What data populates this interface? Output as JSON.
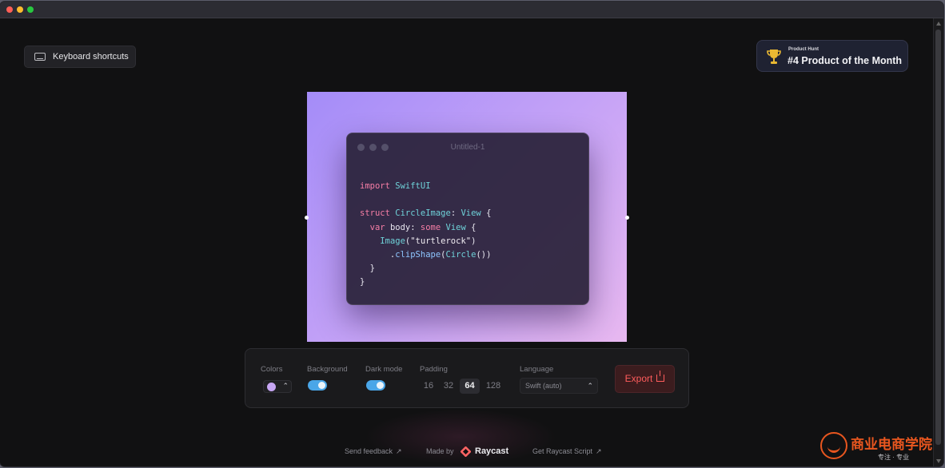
{
  "window": {
    "traffic_lights": [
      "close",
      "minimize",
      "zoom"
    ]
  },
  "header": {
    "keyboard_shortcuts_label": "Keyboard shortcuts",
    "keyboard_icon": "keyboard-icon",
    "badge": {
      "small_text": "Product Hunt",
      "big_text": "#4 Product of the Month",
      "icon": "trophy-icon"
    }
  },
  "editor": {
    "window_title": "Untitled-1",
    "code_lines": [
      "import SwiftUI",
      "",
      "struct CircleImage: View {",
      "  var body: some View {",
      "    Image(\"turtlerock\")",
      "      .clipShape(Circle())",
      "  }",
      "}"
    ],
    "gradient_colors": [
      "#a48cf8",
      "#c4a2f7",
      "#e8b8f0"
    ]
  },
  "toolbar": {
    "colors_label": "Colors",
    "background_label": "Background",
    "dark_mode_label": "Dark mode",
    "padding_label": "Padding",
    "language_label": "Language",
    "selected_color": "#c7a6f4",
    "background_on": true,
    "dark_mode_on": true,
    "padding_options": [
      "16",
      "32",
      "64",
      "128"
    ],
    "padding_selected": "64",
    "language_value": "Swift (auto)",
    "export_label": "Export",
    "export_icon": "share-icon",
    "accent_color": "#ff5c5c",
    "toggle_color": "#4aa6e8"
  },
  "footer": {
    "send_feedback": "Send feedback",
    "made_by": "Made by",
    "brand": "Raycast",
    "get_script": "Get Raycast Script",
    "arrow": "↗"
  },
  "watermark": {
    "title": "商业电商学院",
    "subtitle": "专注 · 专业"
  }
}
